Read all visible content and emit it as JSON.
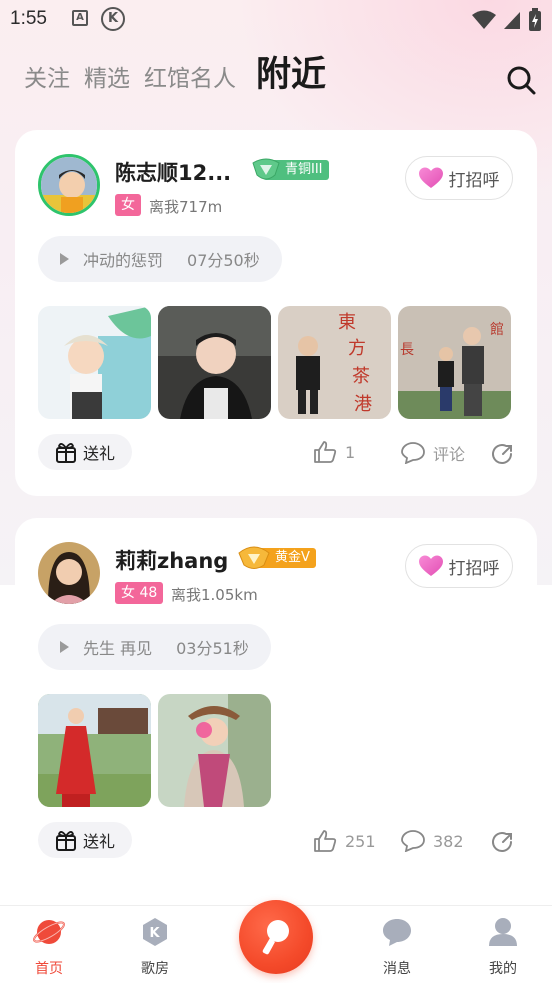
{
  "status_bar": {
    "time": "1:55",
    "icon_a": "A",
    "icon_k": "K"
  },
  "tabs": [
    {
      "label": "关注"
    },
    {
      "label": "精选"
    },
    {
      "label": "红馆名人"
    },
    {
      "label": "附近"
    }
  ],
  "posts": [
    {
      "name": "陈志顺12...",
      "rank": "青铜III",
      "gender": "女",
      "distance": "离我717m",
      "greet_label": "打招呼",
      "voice_title": "冲动的惩罚",
      "voice_duration": "07分50秒",
      "photo_count": 4,
      "gift_label": "送礼",
      "like_count": "1",
      "comment_label": "评论"
    },
    {
      "name": "莉莉zhang",
      "rank": "黄金V",
      "gender": "女 48",
      "distance": "离我1.05km",
      "greet_label": "打招呼",
      "voice_title": "先生 再见",
      "voice_duration": "03分51秒",
      "photo_count": 2,
      "gift_label": "送礼",
      "like_count": "251",
      "comment_label": "382"
    }
  ],
  "bottom_nav": [
    {
      "label": "首页",
      "icon": "planet-icon",
      "active": true
    },
    {
      "label": "歌房",
      "icon": "k-room-icon",
      "active": false
    },
    {
      "label": "",
      "icon": "microphone-icon",
      "active": false
    },
    {
      "label": "消息",
      "icon": "chat-bubble-icon",
      "active": false
    },
    {
      "label": "我的",
      "icon": "person-icon",
      "active": false
    }
  ],
  "colors": {
    "accent": "#ef4a3a",
    "rank_bronze": "#4fbf7f",
    "rank_gold": "#f4a21c",
    "gender_badge": "#f3679a"
  }
}
